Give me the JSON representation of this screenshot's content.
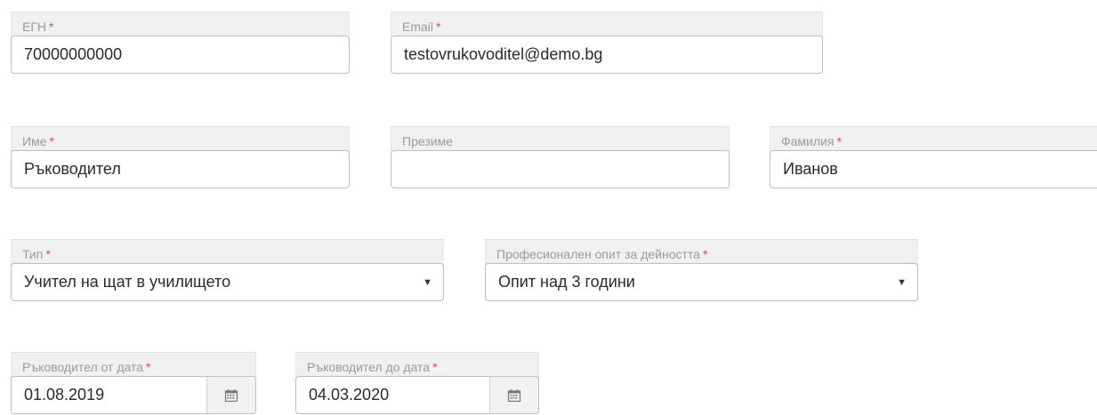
{
  "form": {
    "egn": {
      "label": "ЕГН",
      "required_mark": "*",
      "value": "70000000000"
    },
    "email": {
      "label": "Email",
      "required_mark": "*",
      "value": "testovrukovoditel@demo.bg"
    },
    "first_name": {
      "label": "Име",
      "required_mark": "*",
      "value": "Ръководител"
    },
    "middle_name": {
      "label": "Презиме",
      "value": ""
    },
    "last_name": {
      "label": "Фамилия",
      "required_mark": "*",
      "value": "Иванов"
    },
    "type": {
      "label": "Тип",
      "required_mark": "*",
      "value": "Учител на щат в училището",
      "caret": "▼"
    },
    "experience": {
      "label": "Професионален опит за дейността",
      "required_mark": "*",
      "value": "Опит над 3 години",
      "caret": "▼"
    },
    "date_from": {
      "label": "Ръководител от дата",
      "required_mark": "*",
      "value": "01.08.2019",
      "icon": "calendar-icon"
    },
    "date_to": {
      "label": "Ръководител до дата",
      "required_mark": "*",
      "value": "04.03.2020",
      "icon": "calendar-icon"
    }
  }
}
